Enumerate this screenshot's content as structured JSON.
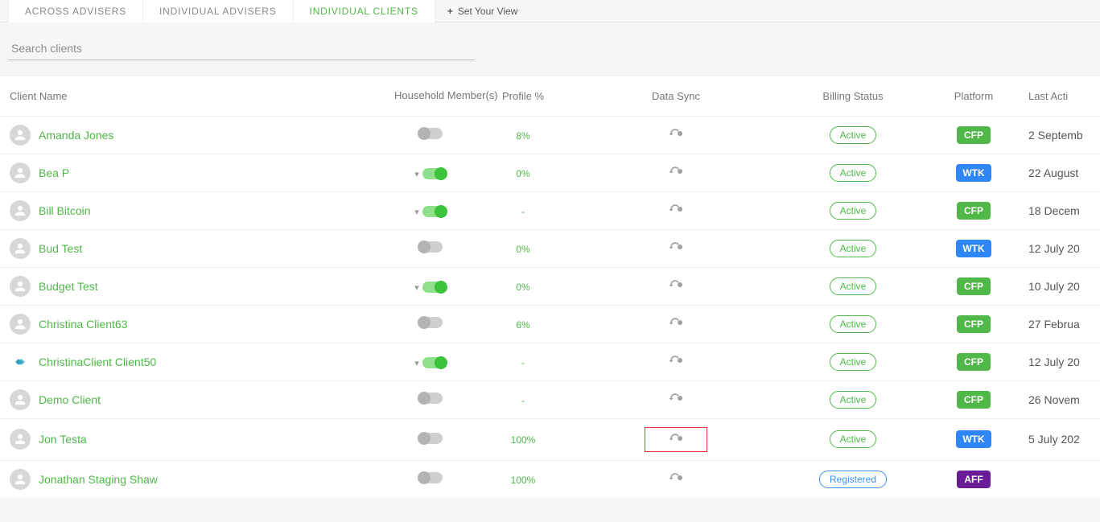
{
  "tabs": {
    "across": "ACROSS ADVISERS",
    "individual_advisers": "INDIVIDUAL ADVISERS",
    "individual_clients": "INDIVIDUAL CLIENTS",
    "set_view": "Set Your View",
    "plus": "+"
  },
  "search": {
    "placeholder": "Search clients"
  },
  "headers": {
    "client_name": "Client Name",
    "household": "Household Member(s)",
    "profile_pct": "Profile %",
    "data_sync": "Data Sync",
    "billing_status": "Billing Status",
    "platform": "Platform",
    "last_activity": "Last Acti"
  },
  "rows": [
    {
      "name": "Amanda Jones",
      "avatar": "person",
      "chevron": false,
      "toggle": false,
      "profile": "8%",
      "sync": true,
      "highlight": false,
      "status": "Active",
      "status_class": "active",
      "platform": "CFP",
      "platform_class": "cfp",
      "last": "2 Septemb"
    },
    {
      "name": "Bea P",
      "avatar": "person",
      "chevron": true,
      "toggle": true,
      "profile": "0%",
      "sync": true,
      "highlight": false,
      "status": "Active",
      "status_class": "active",
      "platform": "WTK",
      "platform_class": "wtk",
      "last": "22 August"
    },
    {
      "name": "Bill Bitcoin",
      "avatar": "person",
      "chevron": true,
      "toggle": true,
      "profile": "-",
      "sync": true,
      "highlight": false,
      "status": "Active",
      "status_class": "active",
      "platform": "CFP",
      "platform_class": "cfp",
      "last": "18 Decem"
    },
    {
      "name": "Bud Test",
      "avatar": "person",
      "chevron": false,
      "toggle": false,
      "profile": "0%",
      "sync": true,
      "highlight": false,
      "status": "Active",
      "status_class": "active",
      "platform": "WTK",
      "platform_class": "wtk",
      "last": "12 July 20"
    },
    {
      "name": "Budget Test",
      "avatar": "person",
      "chevron": true,
      "toggle": true,
      "profile": "0%",
      "sync": true,
      "highlight": false,
      "status": "Active",
      "status_class": "active",
      "platform": "CFP",
      "platform_class": "cfp",
      "last": "10 July 20"
    },
    {
      "name": "Christina Client63",
      "avatar": "person",
      "chevron": false,
      "toggle": false,
      "profile": "6%",
      "sync": true,
      "highlight": false,
      "status": "Active",
      "status_class": "active",
      "platform": "CFP",
      "platform_class": "cfp",
      "last": "27 Februa"
    },
    {
      "name": "ChristinaClient Client50",
      "avatar": "diamond",
      "chevron": true,
      "toggle": true,
      "profile": "-",
      "sync": true,
      "highlight": false,
      "status": "Active",
      "status_class": "active",
      "platform": "CFP",
      "platform_class": "cfp",
      "last": "12 July 20"
    },
    {
      "name": "Demo Client",
      "avatar": "person",
      "chevron": false,
      "toggle": false,
      "profile": "-",
      "sync": true,
      "highlight": false,
      "status": "Active",
      "status_class": "active",
      "platform": "CFP",
      "platform_class": "cfp",
      "last": "26 Novem"
    },
    {
      "name": "Jon Testa",
      "avatar": "person",
      "chevron": false,
      "toggle": false,
      "profile": "100%",
      "sync": true,
      "highlight": true,
      "status": "Active",
      "status_class": "active",
      "platform": "WTK",
      "platform_class": "wtk",
      "last": "5 July 202"
    },
    {
      "name": "Jonathan Staging Shaw",
      "avatar": "person",
      "chevron": false,
      "toggle": false,
      "profile": "100%",
      "sync": true,
      "highlight": false,
      "status": "Registered",
      "status_class": "registered",
      "platform": "AFF",
      "platform_class": "aff",
      "last": ""
    }
  ]
}
